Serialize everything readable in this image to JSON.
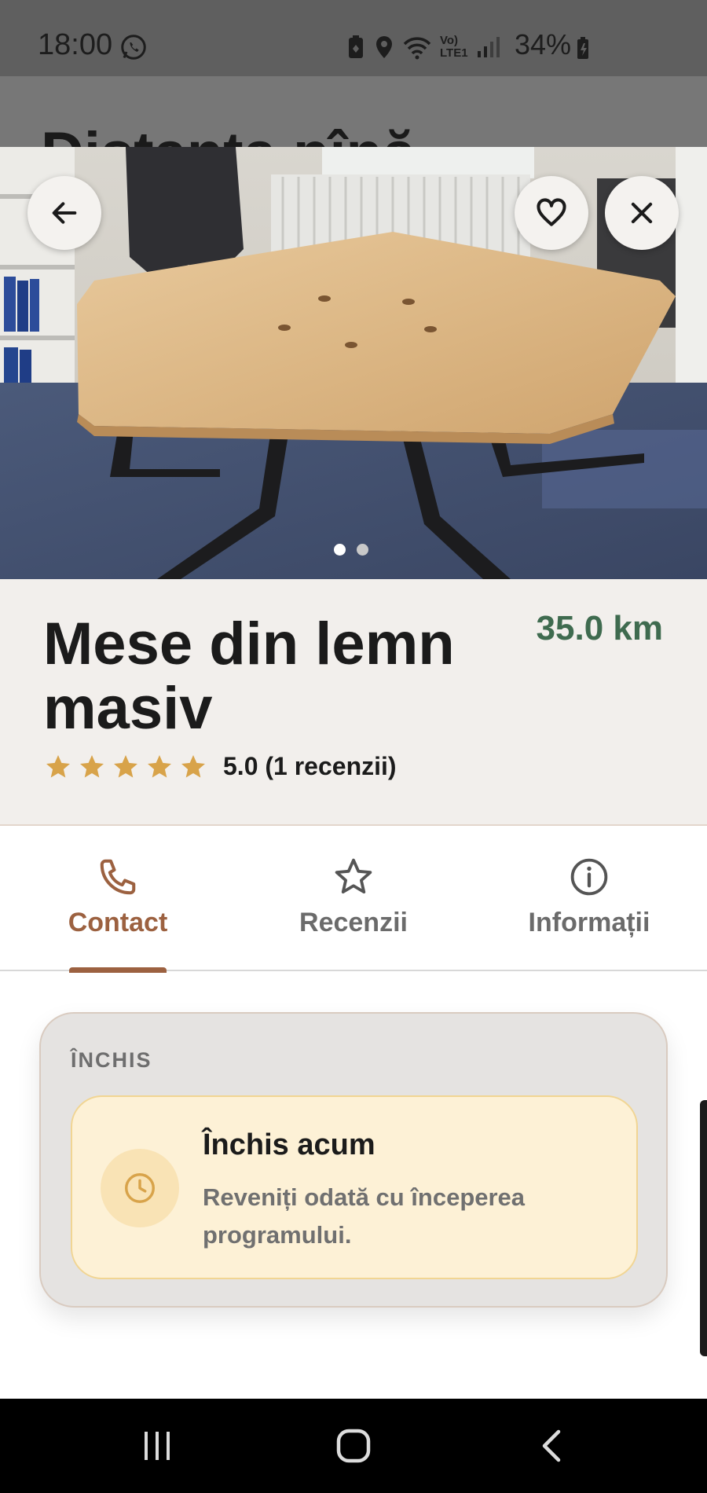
{
  "status_bar": {
    "time": "18:00",
    "battery": "34%",
    "network_label": "Vo) LTE1",
    "icons": [
      "whatsapp-icon",
      "battery-saver-icon",
      "location-icon",
      "wifi-icon",
      "volte-icon",
      "signal-icon",
      "battery-icon"
    ]
  },
  "behind_header": {
    "partial_title": "Distanța pînă"
  },
  "hero": {
    "image_description": "wooden-table-photo",
    "back_icon": "arrow-left-icon",
    "favorite_icon": "heart-icon",
    "close_icon": "close-icon",
    "image_count": 2,
    "active_index": 0
  },
  "listing": {
    "title": "Mese din lemn masiv",
    "distance": "35.0 km",
    "rating_stars": 5,
    "rating_text": "5.0 (1 recenzii)"
  },
  "tabs": [
    {
      "label": "Contact",
      "icon": "phone-icon",
      "active": true
    },
    {
      "label": "Recenzii",
      "icon": "star-outline-icon",
      "active": false
    },
    {
      "label": "Informații",
      "icon": "info-icon",
      "active": false
    }
  ],
  "hours": {
    "status_label": "ÎNCHIS",
    "closed_title": "Închis acum",
    "closed_description": "Reveniți odată cu începerea programului.",
    "icon": "clock-icon"
  },
  "nav_bar": {
    "buttons": [
      "recent-apps-icon",
      "home-icon",
      "back-icon"
    ]
  },
  "colors": {
    "accent_brown": "#9c6140",
    "distance_green": "#3f6b4f",
    "star_gold": "#d8a34a",
    "closed_bg": "#fdf1d6"
  }
}
